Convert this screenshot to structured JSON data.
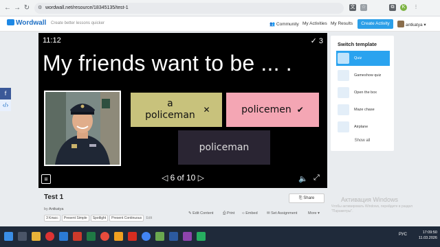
{
  "browser": {
    "url": "wordwall.net/resource/18345135/test-1"
  },
  "site": {
    "logo": "Wordwall",
    "tagline": "Create better lessons quicker",
    "nav": [
      "Community",
      "My Activities",
      "My Results"
    ],
    "create_button": "Create Activity",
    "username": "antkatya"
  },
  "game": {
    "timer": "11:12",
    "score": "3",
    "question": "My friends want to be ... .",
    "answers": [
      {
        "text": "a policeman",
        "mark": "✕"
      },
      {
        "text": "policemen",
        "mark": "✔"
      },
      {
        "text": "policeman",
        "mark": ""
      }
    ],
    "pager": "6 of 10"
  },
  "switch_template": {
    "title": "Switch template",
    "items": [
      "Quiz",
      "Gameshow quiz",
      "Open the box",
      "Maze chase",
      "Airplane"
    ],
    "selected_index": 0,
    "show_all": "Show all"
  },
  "activity": {
    "title": "Test 1",
    "by_label": "by",
    "author": "Antkatya",
    "tags": [
      "3 Класс",
      "Present Simple",
      "Spotlight",
      "Present Continuous"
    ],
    "edit_tags": "Edit",
    "share": "Share",
    "actions": [
      "Edit Content",
      "Print",
      "Embed",
      "Set Assignment",
      "More"
    ]
  },
  "windows": {
    "activation_title": "Активация Windows",
    "activation_text": "Чтобы активировать Windows, перейдите в раздел \"Параметры\".",
    "lang": "РУС",
    "time": "17:09:50",
    "date": "11.03.2026"
  },
  "colors": {
    "answer_1": "#c8c27c",
    "answer_2": "#f4a6b4",
    "answer_3": "#2a2533",
    "accent": "#2aa3ef"
  }
}
